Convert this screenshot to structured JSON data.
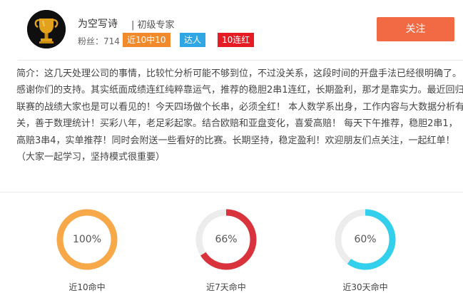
{
  "profile": {
    "name": "为空写诗",
    "level": "| 初级专家",
    "fans": "粉丝：714",
    "badges": [
      {
        "label": "近10中10",
        "color": "#f08a2c"
      },
      {
        "label": "达人",
        "color": "#2fa7e4"
      },
      {
        "label": "10连红",
        "color": "#e51c23"
      }
    ],
    "follow_label": "关注"
  },
  "intro": {
    "lines": [
      "简介：这几天处理公司的事情，比较忙分析可能不够到位，不过没关系，这段时间的开盘手法已经很明确了。",
      "感谢你们的支持。其实纸面成绩连红纯粹靠运气，推荐的稳胆2串1连红，长期盈利，那才是靠实力。最近回归",
      "联赛的战绩大家也是可以看见的！今天四场做个长串，必须全红！ 本人数学系出身，工作内容与大数据分析有",
      "关，善于数理统计！买彩八年，老足彩起家。结合欧赔和亚盘变化，喜爱高赔！ 每天下午推荐，稳胆2串1，",
      "高赔3串4，实单推荐！同时会附送一些看好的比赛。长期坚持，稳定盈利！欢迎朋友们点关注，一起红单！",
      "（大家一起学习，坚持模式很重要）"
    ]
  },
  "stats": [
    {
      "percent_text": "100%",
      "value": 100,
      "label": "近10命中",
      "color": "#f7a94a"
    },
    {
      "percent_text": "66%",
      "value": 66,
      "label": "近7天命中",
      "color": "#d9343e"
    },
    {
      "percent_text": "60%",
      "value": 60,
      "label": "近30天命中",
      "color": "#33d0ee"
    }
  ],
  "colors": {
    "ring_track": "#ececec"
  }
}
